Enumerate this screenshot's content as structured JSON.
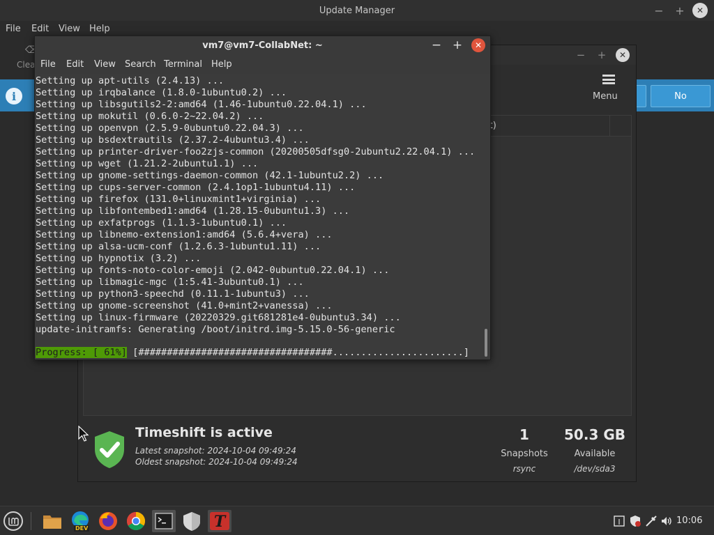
{
  "update_manager": {
    "title": "Update Manager",
    "menu": [
      "File",
      "Edit",
      "View",
      "Help"
    ],
    "clear_label": "Clea",
    "no_button": "No"
  },
  "timeshift": {
    "menu_label": "Menu",
    "column_partial": "it)",
    "status_title": "Timeshift is active",
    "latest_snapshot": "Latest snapshot: 2024-10-04 09:49:24",
    "oldest_snapshot": "Oldest snapshot: 2024-10-04 09:49:24",
    "snapshots": {
      "value": "1",
      "label": "Snapshots",
      "sub": "rsync"
    },
    "available": {
      "value": "50.3 GB",
      "label": "Available",
      "sub": "/dev/sda3"
    },
    "shield_color": "#5ab552"
  },
  "terminal": {
    "title": "vm7@vm7-CollabNet: ~",
    "menu": [
      "File",
      "Edit",
      "View",
      "Search",
      "Terminal",
      "Help"
    ],
    "lines": [
      "Setting up apt-utils (2.4.13) ...",
      "Setting up irqbalance (1.8.0-1ubuntu0.2) ...",
      "Setting up libsgutils2-2:amd64 (1.46-1ubuntu0.22.04.1) ...",
      "Setting up mokutil (0.6.0-2~22.04.2) ...",
      "Setting up openvpn (2.5.9-0ubuntu0.22.04.3) ...",
      "Setting up bsdextrautils (2.37.2-4ubuntu3.4) ...",
      "Setting up printer-driver-foo2zjs-common (20200505dfsg0-2ubuntu2.22.04.1) ...",
      "Setting up wget (1.21.2-2ubuntu1.1) ...",
      "Setting up gnome-settings-daemon-common (42.1-1ubuntu2.2) ...",
      "Setting up cups-server-common (2.4.1op1-1ubuntu4.11) ...",
      "Setting up firefox (131.0+linuxmint1+virginia) ...",
      "Setting up libfontembed1:amd64 (1.28.15-0ubuntu1.3) ...",
      "Setting up exfatprogs (1.1.3-1ubuntu0.1) ...",
      "Setting up libnemo-extension1:amd64 (5.6.4+vera) ...",
      "Setting up alsa-ucm-conf (1.2.6.3-1ubuntu1.11) ...",
      "Setting up hypnotix (3.2) ...",
      "Setting up fonts-noto-color-emoji (2.042-0ubuntu0.22.04.1) ...",
      "Setting up libmagic-mgc (1:5.41-3ubuntu0.1) ...",
      "Setting up python3-speechd (0.11.1-1ubuntu3) ...",
      "Setting up gnome-screenshot (41.0+mint2+vanessa) ...",
      "Setting up linux-firmware (20220329.git681281e4-0ubuntu3.34) ...",
      "update-initramfs: Generating /boot/initrd.img-5.15.0-56-generic"
    ],
    "progress_label": "Progress: [ 61%]",
    "progress_bar": " [##################################.......................]",
    "progress_percent": 61,
    "progress_color": "#4e9a06"
  },
  "taskbar": {
    "items": [
      "mint-menu-icon",
      "files-icon",
      "edge-dev-icon",
      "firefox-icon",
      "chrome-icon",
      "terminal-icon",
      "shield-icon",
      "timeshift-icon"
    ],
    "edge_badge": "DEV",
    "clock": "10:06"
  }
}
